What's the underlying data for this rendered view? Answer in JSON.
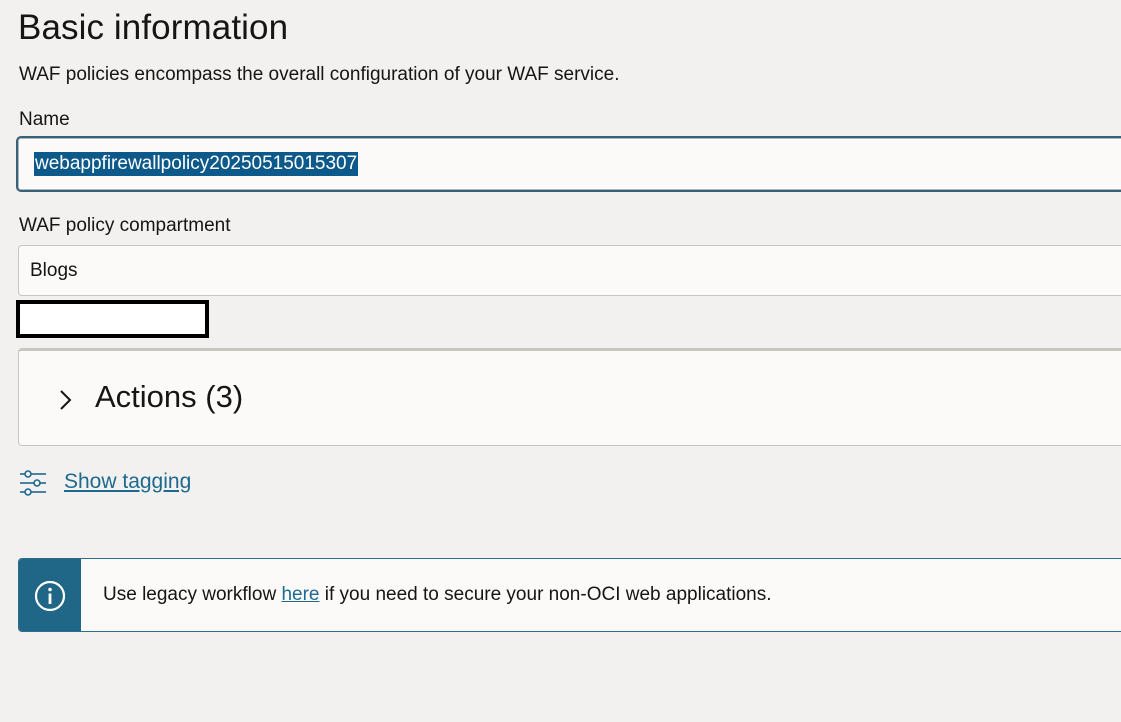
{
  "section": {
    "title": "Basic information",
    "description": "WAF policies encompass the overall configuration of your WAF service."
  },
  "name_field": {
    "label": "Name",
    "value": "webappfirewallpolicy20250515015307"
  },
  "compartment_field": {
    "label": "WAF policy compartment",
    "value": "Blogs"
  },
  "actions_panel": {
    "title": "Actions (3)",
    "icon": "chevron-right-icon"
  },
  "tagging": {
    "link_label": "Show tagging",
    "icon": "sliders-icon"
  },
  "info_banner": {
    "text_before": "Use legacy workflow ",
    "link_label": "here",
    "text_after": " if you need to secure your non-OCI web applications.",
    "icon": "info-icon"
  },
  "colors": {
    "background": "#f2f1ef",
    "link": "#1d6a8e",
    "selection": "#0d5a8a",
    "info_strip": "#1f6687"
  }
}
